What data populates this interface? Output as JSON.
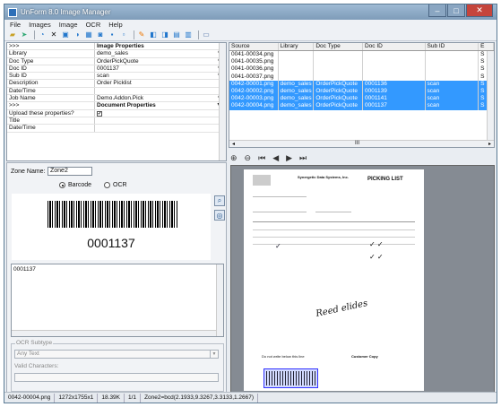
{
  "window": {
    "title": "UnForm 8.0 Image Manager"
  },
  "menu": [
    "File",
    "Images",
    "Image",
    "OCR",
    "Help"
  ],
  "properties": [
    {
      "k": ">>>",
      "v": "Image Properties",
      "hdr": true
    },
    {
      "k": "Library",
      "v": "demo_sales",
      "bin": true
    },
    {
      "k": "Doc Type",
      "v": "OrderPickQuote",
      "bin": true
    },
    {
      "k": "Doc ID",
      "v": "0001137",
      "bin": true
    },
    {
      "k": "Sub ID",
      "v": "scan",
      "bin": true
    },
    {
      "k": "Description",
      "v": "Order Picklist"
    },
    {
      "k": "Date/Time",
      "v": ""
    },
    {
      "k": "Job Name",
      "v": "Demo.Addon.Pick",
      "bin": true
    },
    {
      "k": ">>>",
      "v": "Document Properties",
      "hdr": true
    },
    {
      "k": "Upload these properties?",
      "v": "✔",
      "check": true
    },
    {
      "k": "Title",
      "v": ""
    },
    {
      "k": "Date/Time",
      "v": ""
    }
  ],
  "zone": {
    "name_label": "Zone Name:",
    "name_value": "Zone2",
    "barcode_label": "Barcode",
    "ocr_label": "OCR",
    "barcode_value": "0001137",
    "text_value": "0001137",
    "ocr_subtype_legend": "OCR Subtype",
    "ocr_subtype_value": "Any Text",
    "valid_chars_label": "Valid Characters:"
  },
  "list": {
    "columns": [
      "Source",
      "Library",
      "Doc Type",
      "Doc ID",
      "Sub ID",
      "E"
    ],
    "rows": [
      {
        "cells": [
          "0041-00034.png",
          "",
          "",
          "",
          "",
          "S"
        ],
        "sel": false
      },
      {
        "cells": [
          "0041-00035.png",
          "",
          "",
          "",
          "",
          "S"
        ],
        "sel": false
      },
      {
        "cells": [
          "0041-00036.png",
          "",
          "",
          "",
          "",
          "S"
        ],
        "sel": false
      },
      {
        "cells": [
          "0041-00037.png",
          "",
          "",
          "",
          "",
          "S"
        ],
        "sel": false
      },
      {
        "cells": [
          "0042-00001.png",
          "demo_sales",
          "OrderPickQuote",
          "0001136",
          "scan",
          "S"
        ],
        "sel": true
      },
      {
        "cells": [
          "0042-00002.png",
          "demo_sales",
          "OrderPickQuote",
          "0001139",
          "scan",
          "S"
        ],
        "sel": true
      },
      {
        "cells": [
          "0042-00003.png",
          "demo_sales",
          "OrderPickQuote",
          "0001141",
          "scan",
          "S"
        ],
        "sel": true
      },
      {
        "cells": [
          "0042-00004.png",
          "demo_sales",
          "OrderPickQuote",
          "0001137",
          "scan",
          "S"
        ],
        "sel": true
      }
    ],
    "scroll_label": "III"
  },
  "document": {
    "company": "Synergetic Data Systems, Inc.",
    "title": "PICKING LIST",
    "footer_left": "Do not write below this line",
    "footer_right": "Customer Copy",
    "signature": "Reed elides"
  },
  "status": [
    "0042-00004.png",
    "1272x1755x1",
    "18.39K",
    "1/1",
    "Zone2=bcd(2.1933,9.3267,3.3133,1.2667)"
  ]
}
